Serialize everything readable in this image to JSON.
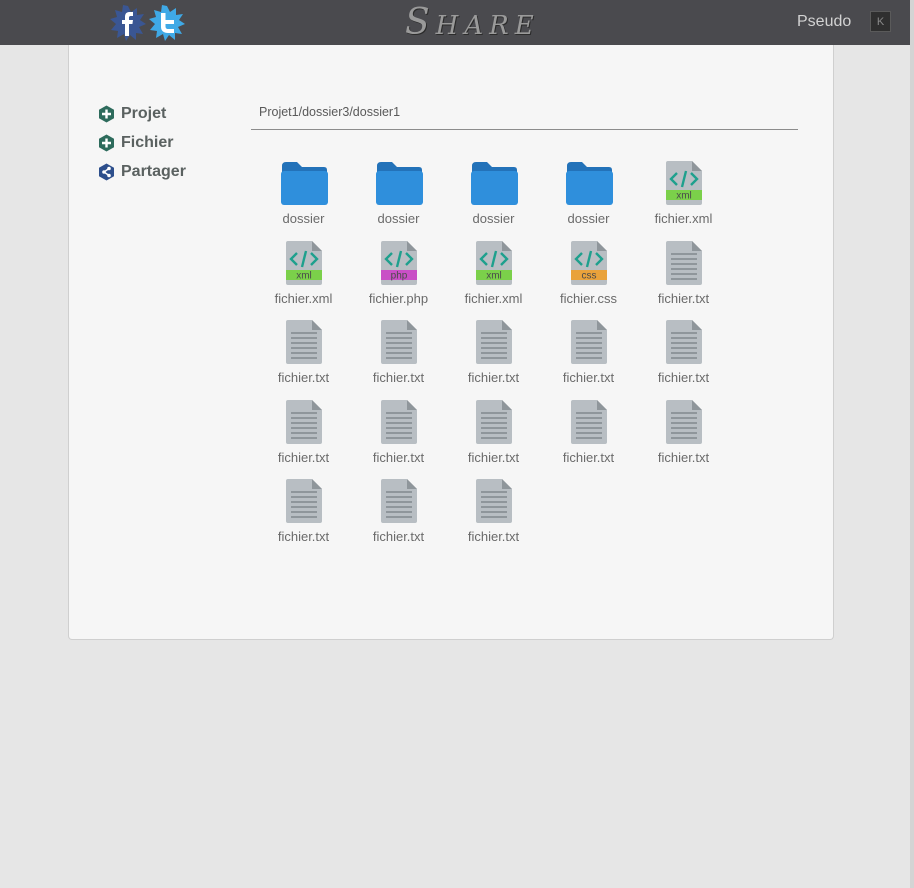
{
  "header": {
    "brand_first": "S",
    "brand_rest": "HARE",
    "username": "Pseudo",
    "logout_label": "K",
    "social": [
      "facebook-icon",
      "twitter-icon"
    ]
  },
  "sidebar": {
    "items": [
      {
        "label": "Projet",
        "icon": "add-icon"
      },
      {
        "label": "Fichier",
        "icon": "add-icon"
      },
      {
        "label": "Partager",
        "icon": "share-icon"
      }
    ]
  },
  "breadcrumb": "Projet1/dossier3/dossier1",
  "files": [
    {
      "name": "dossier",
      "type": "folder"
    },
    {
      "name": "dossier",
      "type": "folder"
    },
    {
      "name": "dossier",
      "type": "folder"
    },
    {
      "name": "dossier",
      "type": "folder"
    },
    {
      "name": "fichier.xml",
      "type": "xml"
    },
    {
      "name": "fichier.xml",
      "type": "xml"
    },
    {
      "name": "fichier.php",
      "type": "php"
    },
    {
      "name": "fichier.xml",
      "type": "xml"
    },
    {
      "name": "fichier.css",
      "type": "css"
    },
    {
      "name": "fichier.txt",
      "type": "txt"
    },
    {
      "name": "fichier.txt",
      "type": "txt"
    },
    {
      "name": "fichier.txt",
      "type": "txt"
    },
    {
      "name": "fichier.txt",
      "type": "txt"
    },
    {
      "name": "fichier.txt",
      "type": "txt"
    },
    {
      "name": "fichier.txt",
      "type": "txt"
    },
    {
      "name": "fichier.txt",
      "type": "txt"
    },
    {
      "name": "fichier.txt",
      "type": "txt"
    },
    {
      "name": "fichier.txt",
      "type": "txt"
    },
    {
      "name": "fichier.txt",
      "type": "txt"
    },
    {
      "name": "fichier.txt",
      "type": "txt"
    },
    {
      "name": "fichier.txt",
      "type": "txt"
    },
    {
      "name": "fichier.txt",
      "type": "txt"
    },
    {
      "name": "fichier.txt",
      "type": "txt"
    }
  ],
  "file_type_labels": {
    "xml": "xml",
    "php": "php",
    "css": "css"
  },
  "colors": {
    "topbar": "#4a4a4e",
    "folder": "#2f8fdc",
    "xml_band": "#7bd04a",
    "php_band": "#c94fc6",
    "css_band": "#e9a23b",
    "code_glyph": "#1ea08d",
    "doc_body": "#b8bec3"
  }
}
